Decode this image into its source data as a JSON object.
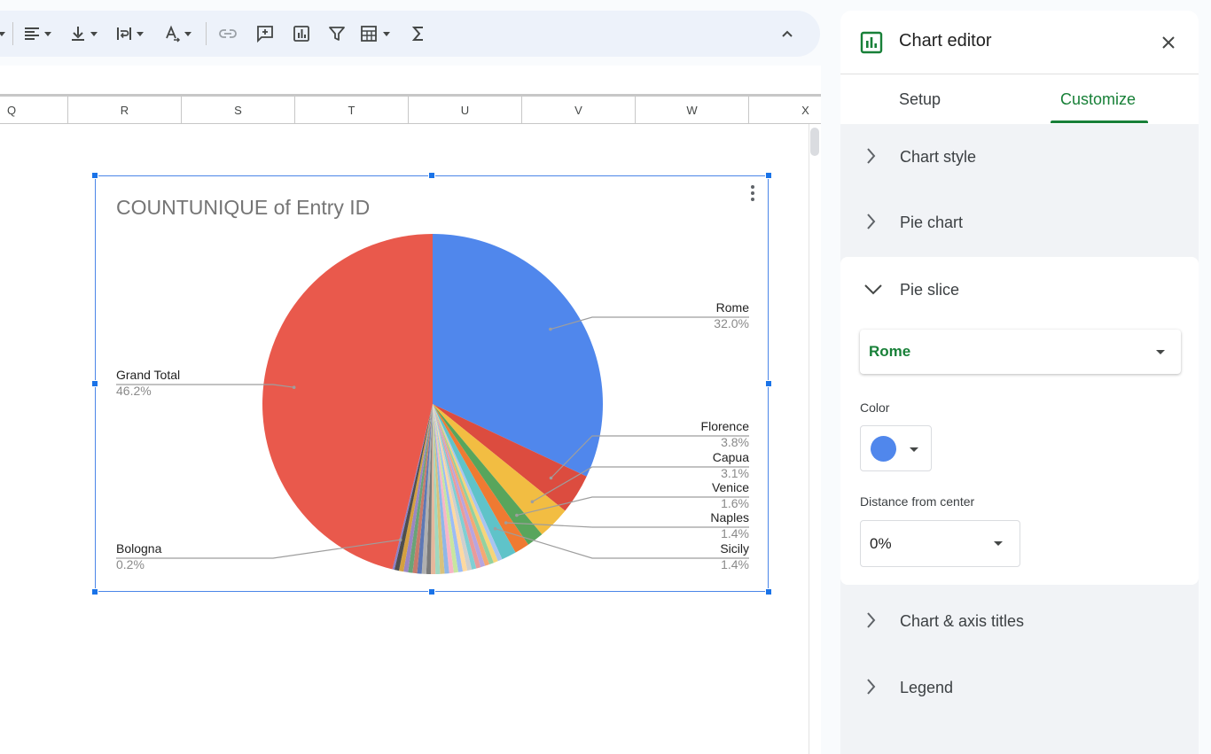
{
  "toolbar": {
    "icons": [
      "align-left-icon",
      "valign-bottom-icon",
      "text-wrap-icon",
      "text-color-icon",
      "link-icon",
      "comment-icon",
      "chart-icon",
      "filter-icon",
      "functions-table-icon",
      "sum-icon",
      "collapse-icon"
    ]
  },
  "columns": [
    "Q",
    "R",
    "S",
    "T",
    "U",
    "V",
    "W",
    "X"
  ],
  "chart": {
    "title": "COUNTUNIQUE of Entry ID"
  },
  "chart_data": {
    "type": "pie",
    "title": "COUNTUNIQUE of Entry ID",
    "slices": [
      {
        "label": "Rome",
        "percent": 32.0,
        "value_label": "32.0%",
        "color": "#5087ec"
      },
      {
        "label": "Florence",
        "percent": 3.8,
        "value_label": "3.8%",
        "color": "#dc4c3f"
      },
      {
        "label": "Capua",
        "percent": 3.1,
        "value_label": "3.1%",
        "color": "#f2bd42"
      },
      {
        "label": "Venice",
        "percent": 1.6,
        "value_label": "1.6%",
        "color": "#58a55c"
      },
      {
        "label": "Naples",
        "percent": 1.4,
        "value_label": "1.4%",
        "color": "#ef7a32"
      },
      {
        "label": "Sicily",
        "percent": 1.4,
        "value_label": "1.4%",
        "color": "#5fc3c9"
      },
      {
        "label": "Bologna",
        "percent": 0.2,
        "value_label": "0.2%",
        "color": "#8a7fc8"
      },
      {
        "label": "Grand Total",
        "percent": 46.2,
        "value_label": "46.2%",
        "color": "#e9594c"
      }
    ],
    "legend": "labeled"
  },
  "panel": {
    "title": "Chart editor",
    "tabs": [
      {
        "label": "Setup",
        "active": false
      },
      {
        "label": "Customize",
        "active": true
      }
    ],
    "sections": {
      "chart_style": "Chart style",
      "pie_chart": "Pie chart",
      "pie_slice": "Pie slice",
      "chart_axis_titles": "Chart & axis titles",
      "legend": "Legend"
    },
    "pie_slice": {
      "selected_slice": "Rome",
      "color_label": "Color",
      "color_value": "#5087ec",
      "distance_label": "Distance from center",
      "distance_value": "0%"
    }
  },
  "colors": {
    "accent_green": "#188038",
    "selection_blue": "#1a73e8"
  }
}
